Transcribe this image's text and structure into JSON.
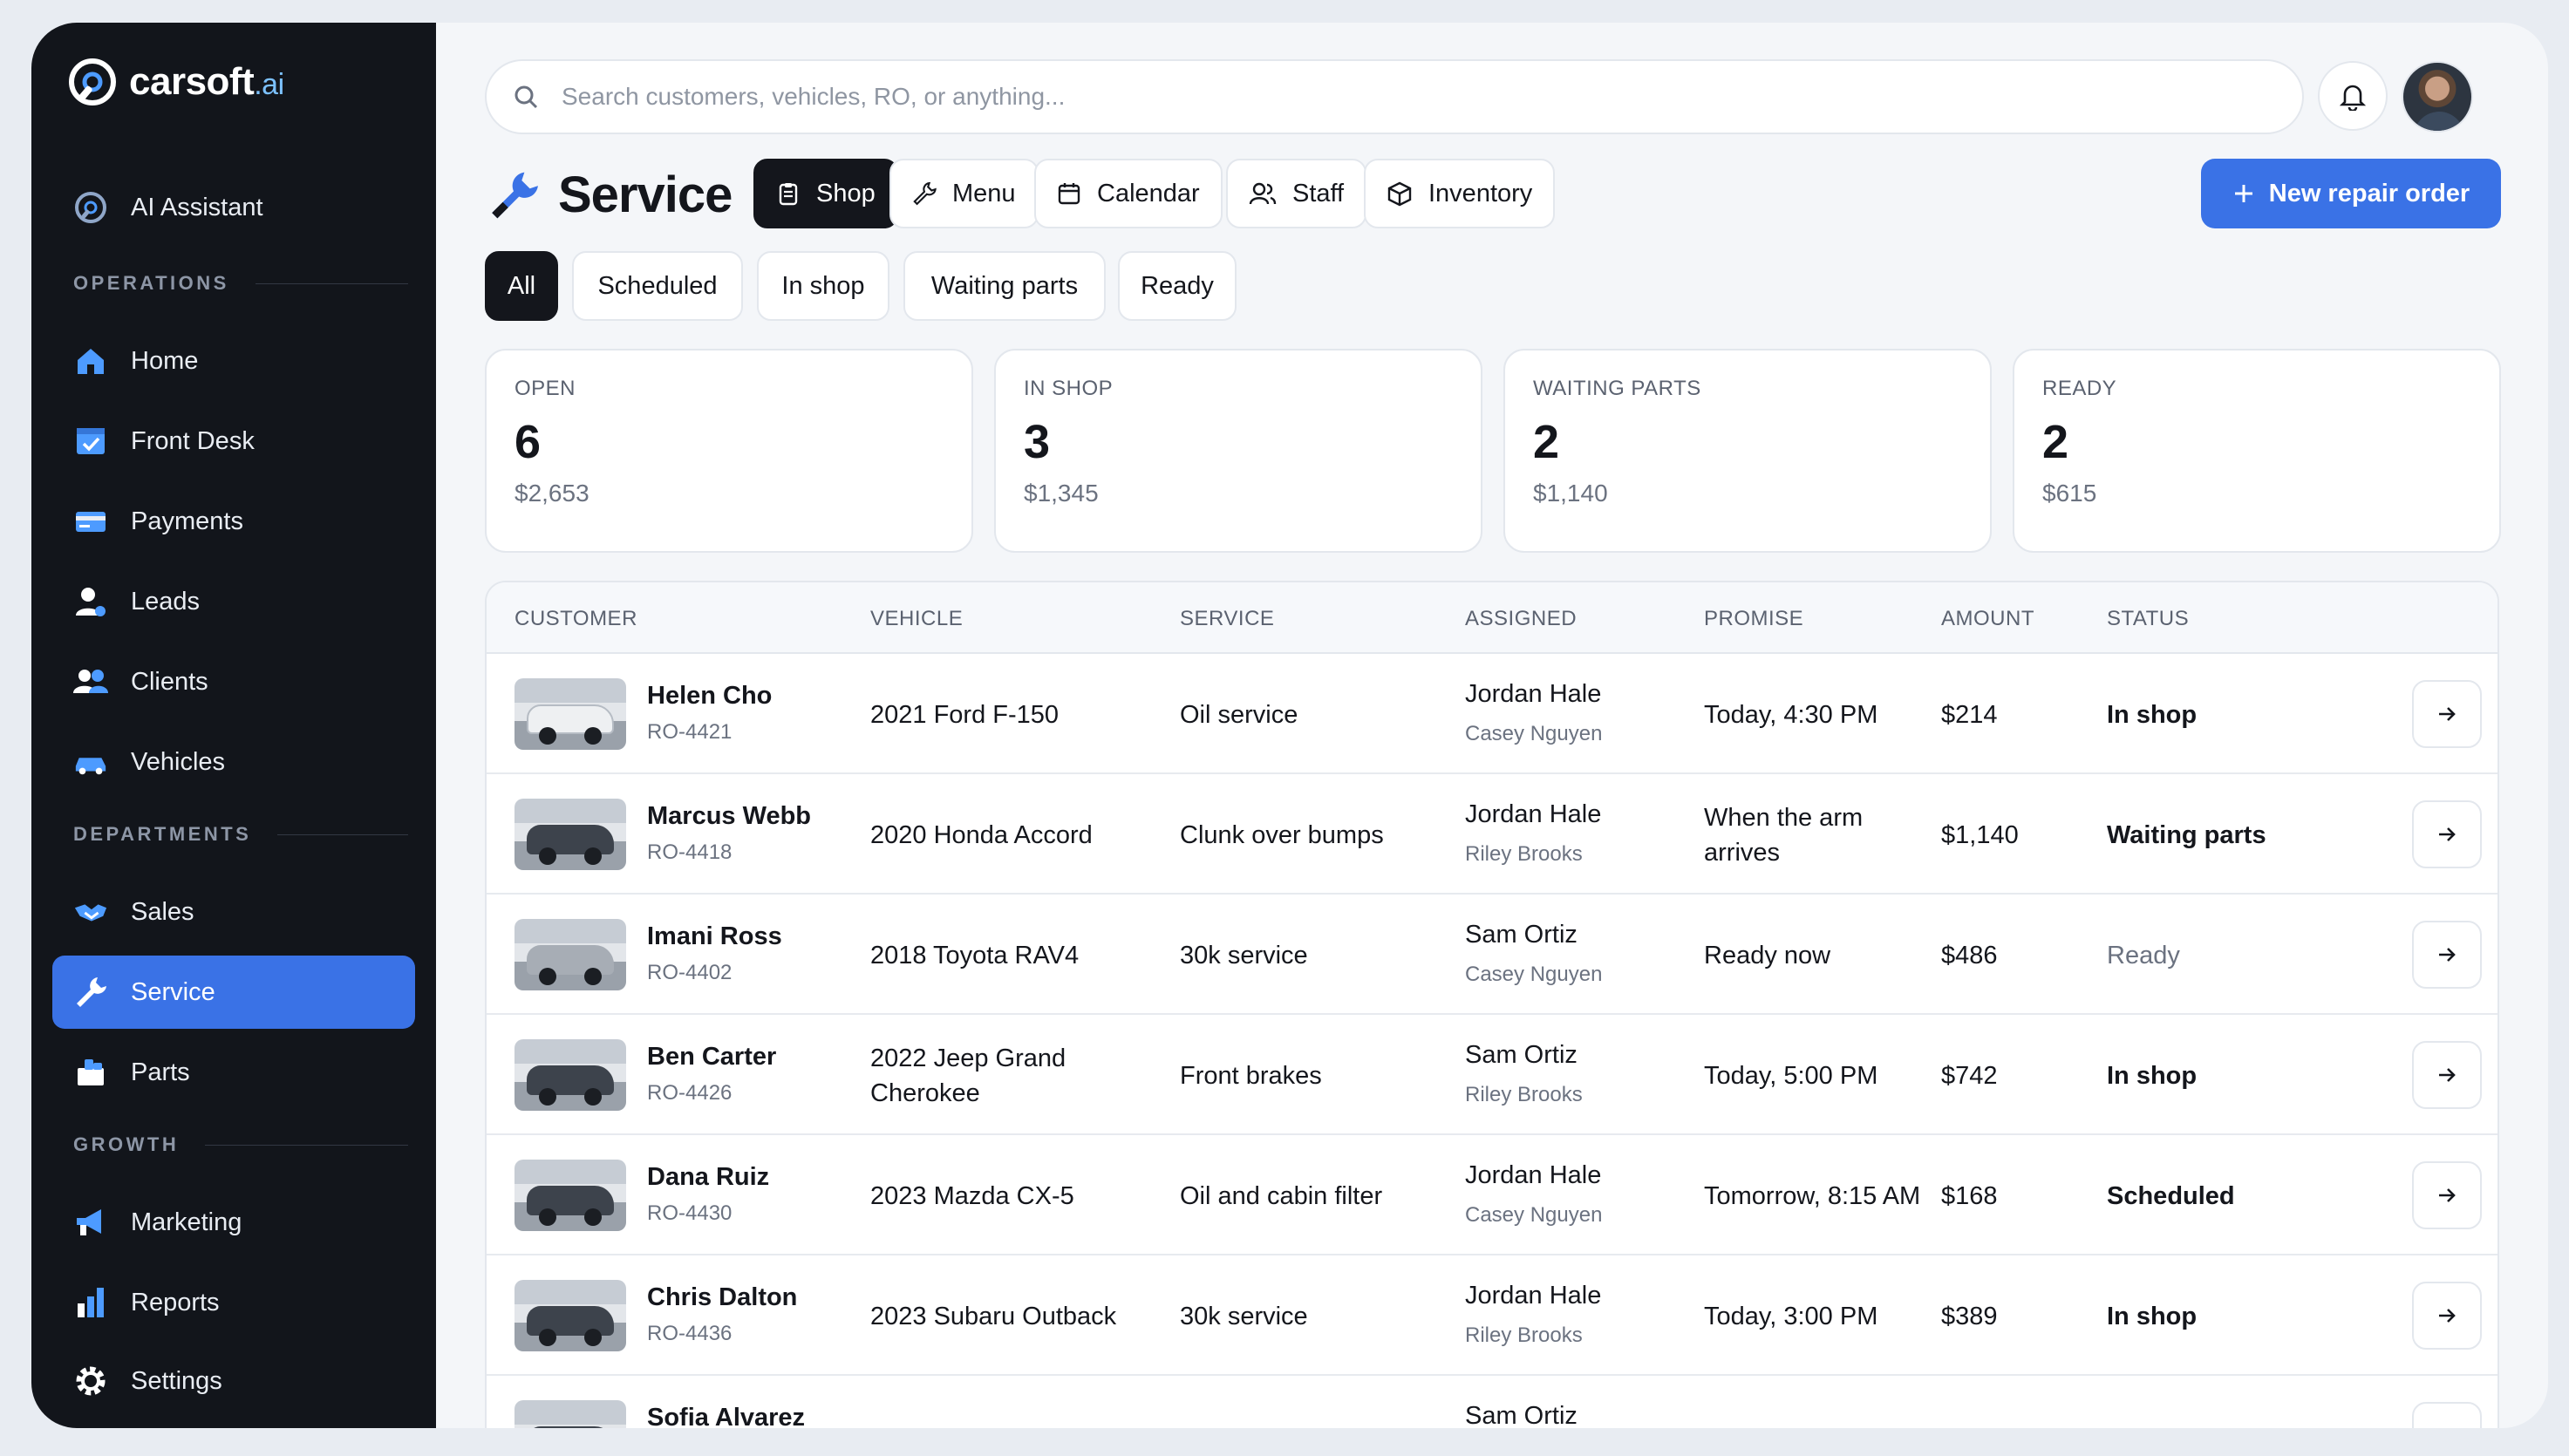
{
  "brand": {
    "name": "carsoft",
    "suffix": ".ai"
  },
  "sidebar": {
    "assistant": {
      "label": "AI Assistant",
      "icon": "assistant-icon"
    },
    "sections": [
      {
        "label": "OPERATIONS",
        "items": [
          {
            "label": "Home",
            "icon": "home-icon"
          },
          {
            "label": "Front Desk",
            "icon": "front-desk-icon"
          },
          {
            "label": "Payments",
            "icon": "credit-card-icon"
          },
          {
            "label": "Leads",
            "icon": "lead-user-icon"
          },
          {
            "label": "Clients",
            "icon": "clients-icon"
          },
          {
            "label": "Vehicles",
            "icon": "car-icon"
          }
        ]
      },
      {
        "label": "DEPARTMENTS",
        "items": [
          {
            "label": "Sales",
            "icon": "handshake-icon"
          },
          {
            "label": "Service",
            "icon": "wrench-icon",
            "active": true
          },
          {
            "label": "Parts",
            "icon": "parts-icon"
          }
        ]
      },
      {
        "label": "GROWTH",
        "items": [
          {
            "label": "Marketing",
            "icon": "megaphone-icon"
          },
          {
            "label": "Reports",
            "icon": "bar-chart-icon"
          }
        ]
      }
    ],
    "settings": {
      "label": "Settings",
      "icon": "gear-icon"
    }
  },
  "search": {
    "placeholder": "Search customers, vehicles, RO, or anything..."
  },
  "header": {
    "title": "Service",
    "tabs": [
      {
        "label": "Shop",
        "icon": "clipboard-icon",
        "active": true
      },
      {
        "label": "Menu",
        "icon": "wrench-icon"
      },
      {
        "label": "Calendar",
        "icon": "calendar-icon"
      },
      {
        "label": "Staff",
        "icon": "staff-icon"
      },
      {
        "label": "Inventory",
        "icon": "box-icon"
      }
    ],
    "new_button": "New repair order"
  },
  "filters": [
    {
      "label": "All",
      "active": true
    },
    {
      "label": "Scheduled"
    },
    {
      "label": "In shop"
    },
    {
      "label": "Waiting parts"
    },
    {
      "label": "Ready"
    }
  ],
  "stats": [
    {
      "label": "OPEN",
      "count": "6",
      "amount": "$2,653"
    },
    {
      "label": "IN SHOP",
      "count": "3",
      "amount": "$1,345"
    },
    {
      "label": "WAITING PARTS",
      "count": "2",
      "amount": "$1,140"
    },
    {
      "label": "READY",
      "count": "2",
      "amount": "$615"
    }
  ],
  "table": {
    "columns": [
      "CUSTOMER",
      "VEHICLE",
      "SERVICE",
      "ASSIGNED",
      "PROMISE",
      "AMOUNT",
      "STATUS"
    ],
    "rows": [
      {
        "name": "Helen Cho",
        "ro": "RO-4421",
        "vehicle": "2021 Ford F-150",
        "service": "Oil service",
        "tech": "Jordan Hale",
        "advisor": "Casey Nguyen",
        "promise": "Today, 4:30 PM",
        "amount": "$214",
        "status": "In shop"
      },
      {
        "name": "Marcus Webb",
        "ro": "RO-4418",
        "vehicle": "2020 Honda Accord",
        "service": "Clunk over bumps",
        "tech": "Jordan Hale",
        "advisor": "Riley Brooks",
        "promise": "When the arm arrives",
        "amount": "$1,140",
        "status": "Waiting parts"
      },
      {
        "name": "Imani Ross",
        "ro": "RO-4402",
        "vehicle": "2018 Toyota RAV4",
        "service": "30k service",
        "tech": "Sam Ortiz",
        "advisor": "Casey Nguyen",
        "promise": "Ready now",
        "amount": "$486",
        "status": "Ready"
      },
      {
        "name": "Ben Carter",
        "ro": "RO-4426",
        "vehicle": "2022 Jeep Grand Cherokee",
        "service": "Front brakes",
        "tech": "Sam Ortiz",
        "advisor": "Riley Brooks",
        "promise": "Today, 5:00 PM",
        "amount": "$742",
        "status": "In shop"
      },
      {
        "name": "Dana Ruiz",
        "ro": "RO-4430",
        "vehicle": "2023 Mazda CX-5",
        "service": "Oil and cabin filter",
        "tech": "Jordan Hale",
        "advisor": "Casey Nguyen",
        "promise": "Tomorrow, 8:15 AM",
        "amount": "$168",
        "status": "Scheduled"
      },
      {
        "name": "Chris Dalton",
        "ro": "RO-4436",
        "vehicle": "2023 Subaru Outback",
        "service": "30k service",
        "tech": "Jordan Hale",
        "advisor": "Riley Brooks",
        "promise": "Today, 3:00 PM",
        "amount": "$389",
        "status": "In shop"
      },
      {
        "name": "Sofia Alvarez",
        "ro": "",
        "vehicle": "",
        "service": "",
        "tech": "Sam Ortiz",
        "advisor": "",
        "promise": "",
        "amount": "",
        "status": ""
      }
    ]
  },
  "colors": {
    "accent": "#3a72e6",
    "sidebar": "#12151b",
    "status_ready": "#6b7280"
  }
}
